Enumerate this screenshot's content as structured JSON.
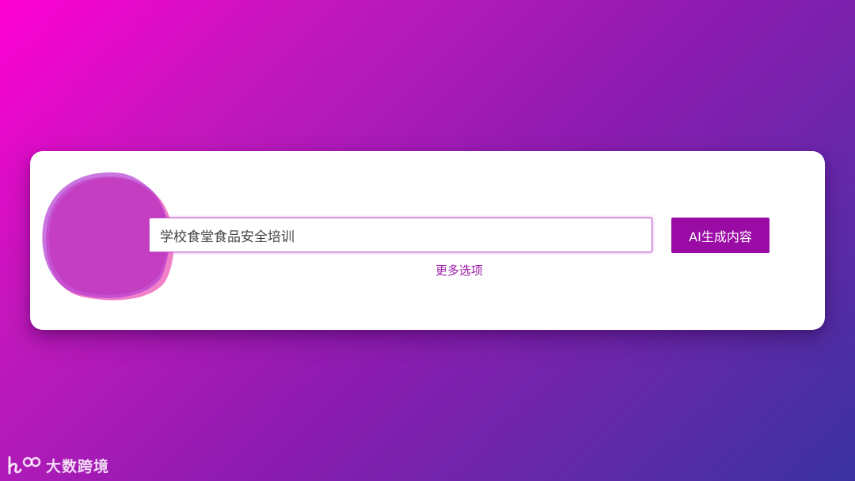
{
  "search": {
    "value": "学校食堂食品安全培训"
  },
  "actions": {
    "generate_label": "AI生成内容",
    "more_options_label": "更多选项"
  },
  "branding": {
    "logo_text": "大数跨境"
  },
  "colors": {
    "accent": "#9a0ba6",
    "link": "#9a1aa8",
    "input_border": "#c04fc8",
    "background_start": "#ff00d4",
    "background_end": "#3a32a0"
  }
}
